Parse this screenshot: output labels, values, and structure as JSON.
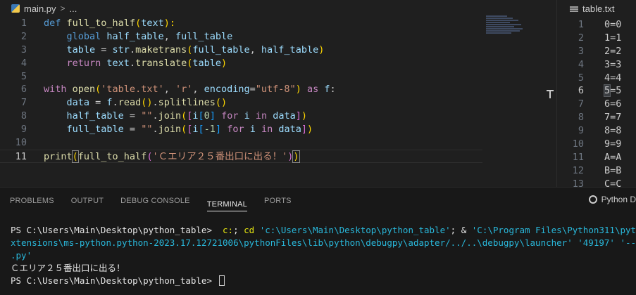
{
  "left_editor": {
    "breadcrumb": {
      "file": "main.py",
      "separator": ">",
      "more": "..."
    },
    "lines": [
      {
        "n": "1",
        "tokens": [
          {
            "t": "def ",
            "c": "kw"
          },
          {
            "t": "full_to_half",
            "c": "fn"
          },
          {
            "t": "(",
            "c": "br1"
          },
          {
            "t": "text",
            "c": "var"
          },
          {
            "t": "):",
            "c": "br1"
          }
        ]
      },
      {
        "n": "2",
        "tokens": [
          {
            "t": "    global ",
            "c": "kw"
          },
          {
            "t": "half_table",
            "c": "var"
          },
          {
            "t": ", ",
            "c": "plain"
          },
          {
            "t": "full_table",
            "c": "var"
          }
        ]
      },
      {
        "n": "3",
        "tokens": [
          {
            "t": "    table",
            "c": "var"
          },
          {
            "t": " = ",
            "c": "plain"
          },
          {
            "t": "str",
            "c": "var"
          },
          {
            "t": ".",
            "c": "plain"
          },
          {
            "t": "maketrans",
            "c": "fn"
          },
          {
            "t": "(",
            "c": "br1"
          },
          {
            "t": "full_table",
            "c": "var"
          },
          {
            "t": ", ",
            "c": "plain"
          },
          {
            "t": "half_table",
            "c": "var"
          },
          {
            "t": ")",
            "c": "br1"
          }
        ]
      },
      {
        "n": "4",
        "tokens": [
          {
            "t": "    return ",
            "c": "kw-ctrl"
          },
          {
            "t": "text",
            "c": "var"
          },
          {
            "t": ".",
            "c": "plain"
          },
          {
            "t": "translate",
            "c": "fn"
          },
          {
            "t": "(",
            "c": "br1"
          },
          {
            "t": "table",
            "c": "var"
          },
          {
            "t": ")",
            "c": "br1"
          }
        ]
      },
      {
        "n": "5",
        "tokens": []
      },
      {
        "n": "6",
        "tokens": [
          {
            "t": "with ",
            "c": "kw-ctrl"
          },
          {
            "t": "open",
            "c": "fn"
          },
          {
            "t": "(",
            "c": "br1"
          },
          {
            "t": "'table.txt'",
            "c": "str"
          },
          {
            "t": ", ",
            "c": "plain"
          },
          {
            "t": "'r'",
            "c": "str"
          },
          {
            "t": ", ",
            "c": "plain"
          },
          {
            "t": "encoding",
            "c": "var"
          },
          {
            "t": "=",
            "c": "plain"
          },
          {
            "t": "\"utf-8\"",
            "c": "str"
          },
          {
            "t": ")",
            "c": "br1"
          },
          {
            "t": " as ",
            "c": "kw-ctrl"
          },
          {
            "t": "f",
            "c": "var"
          },
          {
            "t": ":",
            "c": "plain"
          }
        ]
      },
      {
        "n": "7",
        "tokens": [
          {
            "t": "    data",
            "c": "var"
          },
          {
            "t": " = ",
            "c": "plain"
          },
          {
            "t": "f",
            "c": "var"
          },
          {
            "t": ".",
            "c": "plain"
          },
          {
            "t": "read",
            "c": "fn"
          },
          {
            "t": "()",
            "c": "br1"
          },
          {
            "t": ".",
            "c": "plain"
          },
          {
            "t": "splitlines",
            "c": "fn"
          },
          {
            "t": "()",
            "c": "br1"
          }
        ]
      },
      {
        "n": "8",
        "tokens": [
          {
            "t": "    half_table",
            "c": "var"
          },
          {
            "t": " = ",
            "c": "plain"
          },
          {
            "t": "\"\"",
            "c": "str"
          },
          {
            "t": ".",
            "c": "plain"
          },
          {
            "t": "join",
            "c": "fn"
          },
          {
            "t": "(",
            "c": "br1"
          },
          {
            "t": "[",
            "c": "br2"
          },
          {
            "t": "i",
            "c": "var"
          },
          {
            "t": "[",
            "c": "br3"
          },
          {
            "t": "0",
            "c": "num"
          },
          {
            "t": "]",
            "c": "br3"
          },
          {
            "t": " for ",
            "c": "kw-ctrl"
          },
          {
            "t": "i",
            "c": "var"
          },
          {
            "t": " in ",
            "c": "kw-ctrl"
          },
          {
            "t": "data",
            "c": "var"
          },
          {
            "t": "]",
            "c": "br2"
          },
          {
            "t": ")",
            "c": "br1"
          }
        ]
      },
      {
        "n": "9",
        "tokens": [
          {
            "t": "    full_table",
            "c": "var"
          },
          {
            "t": " = ",
            "c": "plain"
          },
          {
            "t": "\"\"",
            "c": "str"
          },
          {
            "t": ".",
            "c": "plain"
          },
          {
            "t": "join",
            "c": "fn"
          },
          {
            "t": "(",
            "c": "br1"
          },
          {
            "t": "[",
            "c": "br2"
          },
          {
            "t": "i",
            "c": "var"
          },
          {
            "t": "[",
            "c": "br3"
          },
          {
            "t": "-1",
            "c": "num"
          },
          {
            "t": "]",
            "c": "br3"
          },
          {
            "t": " for ",
            "c": "kw-ctrl"
          },
          {
            "t": "i",
            "c": "var"
          },
          {
            "t": " in ",
            "c": "kw-ctrl"
          },
          {
            "t": "data",
            "c": "var"
          },
          {
            "t": "]",
            "c": "br2"
          },
          {
            "t": ")",
            "c": "br1"
          }
        ]
      },
      {
        "n": "10",
        "tokens": []
      },
      {
        "n": "11",
        "active": true,
        "tokens": [
          {
            "t": "print",
            "c": "fn"
          },
          {
            "t": "(",
            "c": "br1 br-match"
          },
          {
            "t": "full_to_half",
            "c": "fn"
          },
          {
            "t": "(",
            "c": "br2"
          },
          {
            "t": "'Ｃエリア２５番出口に出る！'",
            "c": "str"
          },
          {
            "t": ")",
            "c": "br2"
          },
          {
            "t": ")",
            "c": "br1 br-match"
          }
        ]
      }
    ]
  },
  "right_editor": {
    "tab": "table.txt",
    "lines": [
      {
        "n": "1",
        "a": "0",
        "b": "=0"
      },
      {
        "n": "2",
        "a": "1",
        "b": "=1"
      },
      {
        "n": "3",
        "a": "2",
        "b": "=2"
      },
      {
        "n": "4",
        "a": "3",
        "b": "=3"
      },
      {
        "n": "5",
        "a": "4",
        "b": "=4"
      },
      {
        "n": "6",
        "a": "5",
        "b": "=5",
        "active": true
      },
      {
        "n": "7",
        "a": "6",
        "b": "=6"
      },
      {
        "n": "8",
        "a": "7",
        "b": "=7"
      },
      {
        "n": "9",
        "a": "8",
        "b": "=8"
      },
      {
        "n": "10",
        "a": "9",
        "b": "=9"
      },
      {
        "n": "11",
        "a": "A",
        "b": "=A"
      },
      {
        "n": "12",
        "a": "B",
        "b": "=B"
      },
      {
        "n": "13",
        "a": "C",
        "b": "=C"
      }
    ]
  },
  "panel": {
    "tabs": [
      "PROBLEMS",
      "OUTPUT",
      "DEBUG CONSOLE",
      "TERMINAL",
      "PORTS"
    ],
    "active_tab": "TERMINAL",
    "right_label": "Python D",
    "terminal": [
      [
        {
          "t": "PS C:\\Users\\Main\\Desktop\\python_table> ",
          "c": "t-white"
        },
        {
          "t": " c:",
          "c": "t-yellow"
        },
        {
          "t": "; ",
          "c": "t-white"
        },
        {
          "t": "cd",
          "c": "t-yellow"
        },
        {
          "t": " 'c:\\Users\\Main\\Desktop\\python_table'",
          "c": "t-cyan"
        },
        {
          "t": "; & ",
          "c": "t-white"
        },
        {
          "t": "'C:\\Program Files\\Python311\\python.exe'",
          "c": "t-cyan"
        },
        {
          "t": " 'c:\\Users\\Ma",
          "c": "t-cyan"
        }
      ],
      [
        {
          "t": "xtensions\\ms-python.python-2023.17.12721006\\pythonFiles\\lib\\python\\debugpy\\adapter/../..\\debugpy\\launcher' '49197' '--' 'c:\\Use",
          "c": "t-cyan"
        }
      ],
      [
        {
          "t": ".py'",
          "c": "t-cyan"
        }
      ],
      [
        {
          "t": "Ｃエリア２５番出口に出る！",
          "c": "t-white"
        }
      ],
      [
        {
          "t": "PS C:\\Users\\Main\\Desktop\\python_table> ",
          "c": "t-white"
        }
      ]
    ]
  },
  "colors": {
    "background": "#1f1f1f",
    "panel_background": "#181818",
    "keyword": "#569cd6",
    "control_keyword": "#c586c0",
    "function": "#dcdcaa",
    "variable": "#9cdcfe",
    "string": "#ce9178",
    "terminal_yellow": "#e5e510",
    "terminal_cyan": "#29b8db"
  }
}
